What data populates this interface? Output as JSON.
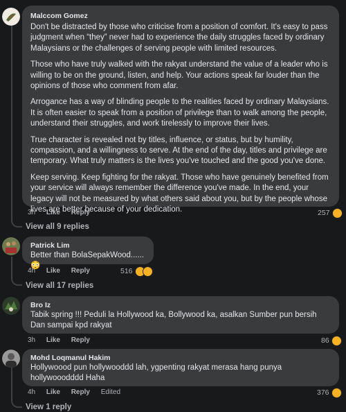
{
  "comments": [
    {
      "author": "Malccom Gomez",
      "paragraphs": [
        "Don't be distracted by those who criticise from a position of comfort. It's easy to pass judgment when “they” never had to experience the daily struggles faced by ordinary Malaysians or the challenges of serving people with limited resources.",
        "Those who have truly walked with the rakyat understand the value of a leader who is willing to be on the ground, listen, and help. Your actions speak far louder than the opinions of those who comment from afar.",
        "Arrogance has a way of blinding people to the realities faced by ordinary Malaysians. It is often easier to speak from a position of privilege than to walk among the people, understand their struggles, and work tirelessly to improve their lives.",
        "True character is revealed not by titles, influence, or status, but by humility, compassion, and a willingness to serve. At the end of the day, titles and privilege are temporary. What truly matters is the lives you've touched and the good you've done.",
        "Keep serving. Keep fighting for the rakyat. Those who have genuinely benefited from your service will always remember the difference you've made. In the end, your legacy will not be measured by what others said about you, but by the people whose lives are better because of your dedication."
      ],
      "time": "3h",
      "like": "Like",
      "reply": "Reply",
      "reaction_count": "257",
      "view_replies": "View all 9 replies"
    },
    {
      "author": "Patrick Lim",
      "text": "Better than BolaSepakWood......😳",
      "time": "4h",
      "like": "Like",
      "reply": "Reply",
      "reaction_count": "516",
      "view_replies": "View all 17 replies"
    },
    {
      "author": "Bro Iz",
      "text": "Tabik spring !!! Peduli la Hollywood ka, Bollywood ka, asalkan Sumber pun bersih Dan sampai kpd rakyat",
      "time": "3h",
      "like": "Like",
      "reply": "Reply",
      "reaction_count": "86"
    },
    {
      "author": "Mohd Loqmanul Hakim",
      "text": "Hollywoood pun hollywooddd lah, ygpenting rakyat merasa hang punya hollywooodddd Haha",
      "time": "4h",
      "like": "Like",
      "reply": "Reply",
      "edited": "Edited",
      "reaction_count": "376",
      "view_replies": "View 1 reply"
    }
  ],
  "colors": {
    "background": "#18191a",
    "bubble": "#3a3b3c",
    "text": "#e4e6eb",
    "muted": "#b0b3b8",
    "reaction": "#f7b125"
  },
  "icons": [
    "haha-reaction-icon",
    "sad-reaction-icon"
  ]
}
